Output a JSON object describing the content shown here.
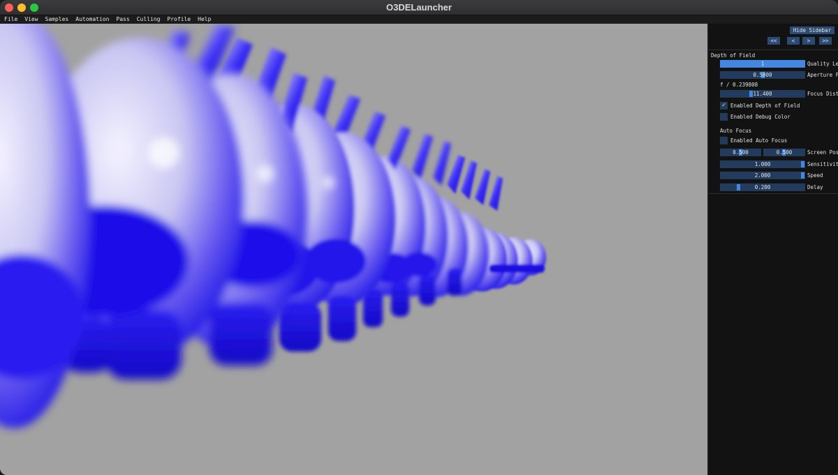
{
  "window": {
    "title": "O3DELauncher"
  },
  "menu": [
    "File",
    "View",
    "Samples",
    "Automation",
    "Pass",
    "Culling",
    "Profile",
    "Help"
  ],
  "sidebar": {
    "hide_label": "Hide Sidebar",
    "nav": [
      "<<",
      "<",
      ">",
      ">>"
    ],
    "dof": {
      "header": "Depth of Field",
      "quality": {
        "value": "1",
        "label": "Quality Le",
        "fraction": 1.0
      },
      "aperture": {
        "value": "0.5000",
        "label": "Aperture F",
        "fraction": 0.5
      },
      "f_stop_text": "f / 0.239808",
      "focus_distance": {
        "value": "11.400",
        "label": "Focus Dist",
        "fraction": 0.35
      },
      "enabled_dof": {
        "label": "Enabled Depth of Field",
        "checked": true
      },
      "enabled_debug": {
        "label": "Enabled Debug Color",
        "checked": false
      }
    },
    "auto_focus": {
      "header": "Auto Focus",
      "enabled": {
        "label": "Enabled Auto Focus",
        "checked": false
      },
      "screen_pos": {
        "x": "0.500",
        "y": "0.500",
        "label": "Screen Pos"
      },
      "sensitivity": {
        "value": "1.000",
        "label": "Sensitivit",
        "fraction": 1.0
      },
      "speed": {
        "value": "2.000",
        "label": "Speed",
        "fraction": 1.0
      },
      "delay": {
        "value": "0.200",
        "label": "Delay",
        "fraction": 0.2
      }
    }
  },
  "colors": {
    "viewport_bg": "#a2a2a2",
    "accent": "#4287e0",
    "frame_bg": "#233b5c",
    "button_bg": "#2b4b75"
  }
}
